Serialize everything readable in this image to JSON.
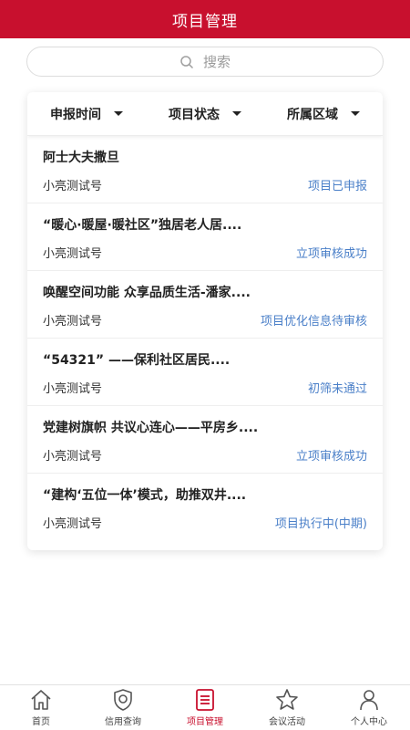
{
  "header": {
    "title": "项目管理"
  },
  "search": {
    "placeholder": "搜索"
  },
  "filters": [
    {
      "label": "申报时间"
    },
    {
      "label": "项目状态"
    },
    {
      "label": "所属区域"
    }
  ],
  "items": [
    {
      "title": "阿士大夫撒旦",
      "owner": "小亮测试号",
      "status": "项目已申报"
    },
    {
      "title": "“暖心·暖屋·暖社区”独居老人居....",
      "owner": "小亮测试号",
      "status": "立项审核成功"
    },
    {
      "title": "唤醒空间功能 众享品质生活-潘家....",
      "owner": "小亮测试号",
      "status": "项目优化信息待审核"
    },
    {
      "title": "“54321” ——保利社区居民....",
      "owner": "小亮测试号",
      "status": "初筛未通过"
    },
    {
      "title": "党建树旗帜 共议心连心——平房乡....",
      "owner": "小亮测试号",
      "status": "立项审核成功"
    },
    {
      "title": "“建构‘五位一体’模式，助推双井....",
      "owner": "小亮测试号",
      "status": "项目执行中(中期)"
    }
  ],
  "tabs": [
    {
      "label": "首页",
      "icon": "home-icon"
    },
    {
      "label": "信用查询",
      "icon": "shield-icon"
    },
    {
      "label": "项目管理",
      "icon": "document-icon",
      "active": true
    },
    {
      "label": "会议活动",
      "icon": "star-icon"
    },
    {
      "label": "个人中心",
      "icon": "user-icon"
    }
  ],
  "colors": {
    "brand": "#c8102e",
    "status": "#4a7fc8"
  }
}
